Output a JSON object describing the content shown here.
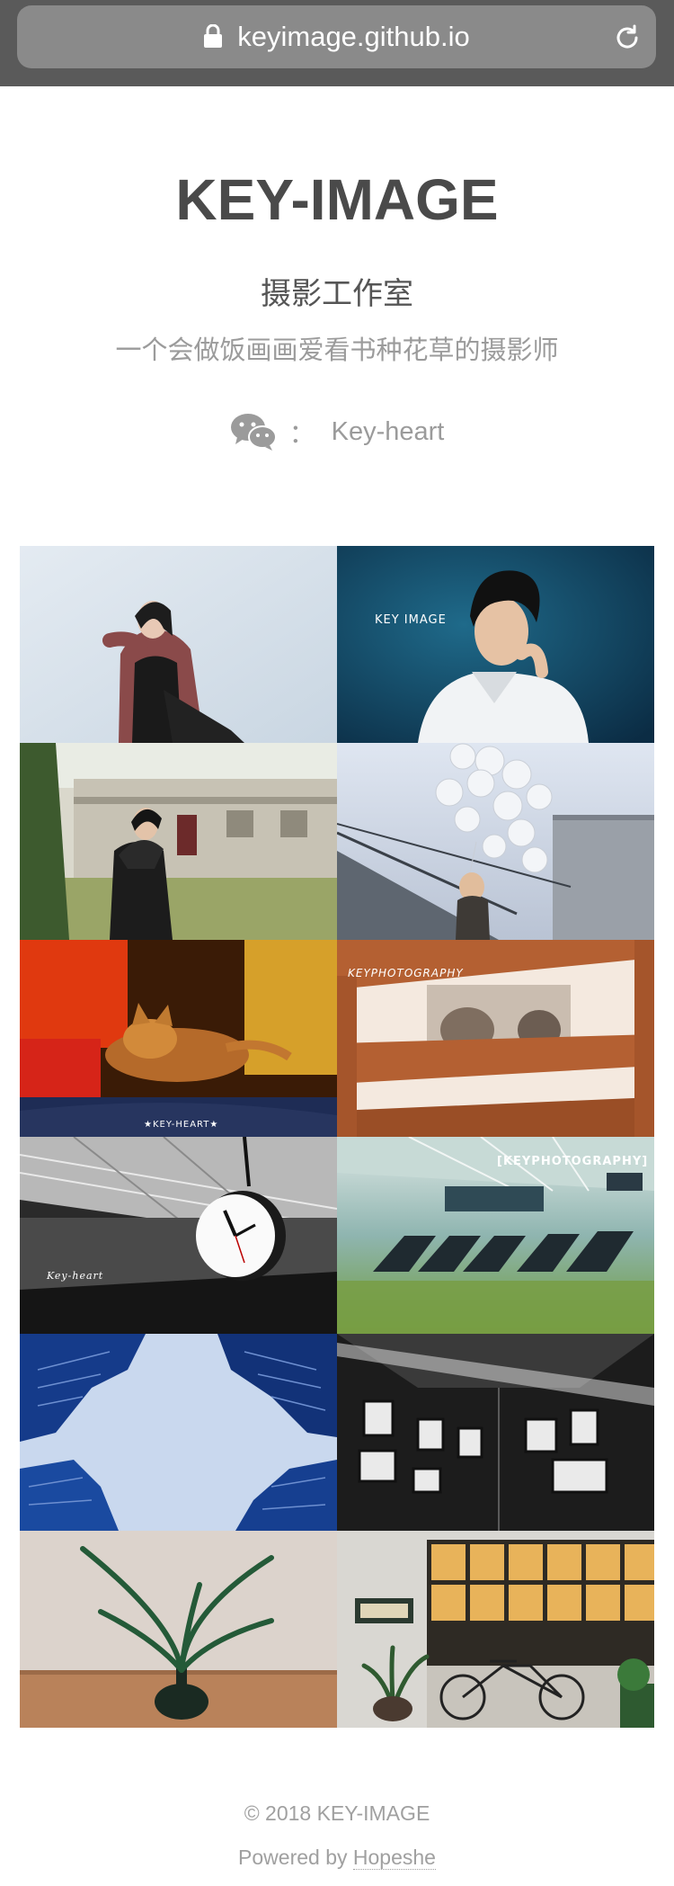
{
  "browser": {
    "url": "keyimage.github.io"
  },
  "header": {
    "title": "KEY-IMAGE",
    "subtitle": "摄影工作室",
    "tagline": "一个会做饭画画爱看书种花草的摄影师",
    "wechat_separator": "：",
    "wechat_id": "Key-heart"
  },
  "gallery": {
    "photos": [
      {
        "alt": "Woman in red cardigan against pale wall"
      },
      {
        "alt": "Young man in white shirt, blue backdrop",
        "watermark": "KEY IMAGE"
      },
      {
        "alt": "Woman in black coat by old white buildings"
      },
      {
        "alt": "Woman with white balloons on a stairway"
      },
      {
        "alt": "Sleeping tabby cat on a red table",
        "watermark": "★KEY-HEART★"
      },
      {
        "alt": "Two kittens peeking through wooden slats",
        "watermark": "KEYPHOTOGRAPHY"
      },
      {
        "alt": "Station clock hanging from ceiling",
        "watermark": "Key-heart"
      },
      {
        "alt": "Airport waiting hall with black seats",
        "watermark": "[KEYPHOTOGRAPHY]"
      },
      {
        "alt": "Blue buildings looking up at the sky"
      },
      {
        "alt": "Framed portraits on a dark gallery wall"
      },
      {
        "alt": "Green plant in a black vase on a wooden table"
      },
      {
        "alt": "Café storefront with bicycle and plants"
      }
    ]
  },
  "footer": {
    "copyright": "© 2018 KEY-IMAGE",
    "powered_prefix": "Powered by ",
    "powered_link": "Hopeshe"
  }
}
